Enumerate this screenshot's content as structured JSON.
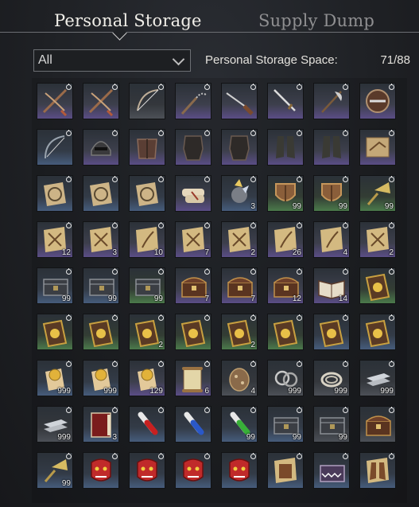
{
  "tabs": {
    "personal": "Personal Storage",
    "supply": "Supply Dump"
  },
  "filter": {
    "selected": "All"
  },
  "storage": {
    "label": "Personal Storage Space:",
    "count": "71/88"
  },
  "colors": {
    "purple": "#5a4d86",
    "blue": "#465c7c",
    "green": "#4b7a4b",
    "gray": "#4c5057",
    "red": "#6a3e48"
  },
  "items": [
    {
      "icon": "crossbow-icon",
      "rarity": "purple",
      "qty": ""
    },
    {
      "icon": "crossbow-icon",
      "rarity": "purple",
      "qty": ""
    },
    {
      "icon": "longbow-icon",
      "rarity": "gray",
      "qty": ""
    },
    {
      "icon": "chain-flail-icon",
      "rarity": "purple",
      "qty": ""
    },
    {
      "icon": "musket-icon",
      "rarity": "purple",
      "qty": ""
    },
    {
      "icon": "sword-icon",
      "rarity": "purple",
      "qty": ""
    },
    {
      "icon": "halberd-icon",
      "rarity": "purple",
      "qty": ""
    },
    {
      "icon": "shield-round-icon",
      "rarity": "purple",
      "qty": ""
    },
    {
      "icon": "bow-blue-icon",
      "rarity": "blue",
      "qty": ""
    },
    {
      "icon": "helmet-icon",
      "rarity": "purple",
      "qty": ""
    },
    {
      "icon": "armor-chest-icon",
      "rarity": "purple",
      "qty": ""
    },
    {
      "icon": "armor-suit-icon",
      "rarity": "purple",
      "qty": ""
    },
    {
      "icon": "armor-suit-icon",
      "rarity": "purple",
      "qty": ""
    },
    {
      "icon": "boots-icon",
      "rarity": "purple",
      "qty": ""
    },
    {
      "icon": "boots-icon",
      "rarity": "purple",
      "qty": ""
    },
    {
      "icon": "map-scroll-icon",
      "rarity": "purple",
      "qty": ""
    },
    {
      "icon": "medallion-icon",
      "rarity": "blue",
      "qty": ""
    },
    {
      "icon": "medallion-icon",
      "rarity": "blue",
      "qty": ""
    },
    {
      "icon": "medallion-icon",
      "rarity": "blue",
      "qty": ""
    },
    {
      "icon": "scroll-bundle-icon",
      "rarity": "purple",
      "qty": ""
    },
    {
      "icon": "crystal-ore-icon",
      "rarity": "blue",
      "qty": "3"
    },
    {
      "icon": "wooden-shield-icon",
      "rarity": "green",
      "qty": "99"
    },
    {
      "icon": "wooden-shield-icon",
      "rarity": "green",
      "qty": "99"
    },
    {
      "icon": "brass-horn-icon",
      "rarity": "green",
      "qty": "99"
    },
    {
      "icon": "crossed-weapons-map-icon",
      "rarity": "purple",
      "qty": "12"
    },
    {
      "icon": "crossed-weapons-map-icon",
      "rarity": "purple",
      "qty": "3"
    },
    {
      "icon": "feather-map-icon",
      "rarity": "purple",
      "qty": "10"
    },
    {
      "icon": "crossed-weapons-map-icon",
      "rarity": "purple",
      "qty": "7"
    },
    {
      "icon": "crossed-weapons-map-icon",
      "rarity": "purple",
      "qty": "2"
    },
    {
      "icon": "feather-map-icon",
      "rarity": "purple",
      "qty": "26"
    },
    {
      "icon": "feather-map-icon",
      "rarity": "purple",
      "qty": "4"
    },
    {
      "icon": "crossed-weapons-map-icon",
      "rarity": "purple",
      "qty": "2"
    },
    {
      "icon": "supply-crate-icon",
      "rarity": "blue",
      "qty": "99"
    },
    {
      "icon": "supply-crate-icon",
      "rarity": "blue",
      "qty": "99"
    },
    {
      "icon": "supply-crate-icon",
      "rarity": "green",
      "qty": "99"
    },
    {
      "icon": "treasure-chest-icon",
      "rarity": "purple",
      "qty": "7"
    },
    {
      "icon": "treasure-chest-icon",
      "rarity": "purple",
      "qty": "7"
    },
    {
      "icon": "treasure-chest-icon",
      "rarity": "purple",
      "qty": "12"
    },
    {
      "icon": "open-book-icon",
      "rarity": "purple",
      "qty": "14"
    },
    {
      "icon": "gold-tome-icon",
      "rarity": "green",
      "qty": ""
    },
    {
      "icon": "gold-tome-icon",
      "rarity": "green",
      "qty": ""
    },
    {
      "icon": "gold-tome-icon",
      "rarity": "green",
      "qty": ""
    },
    {
      "icon": "gold-tome-icon",
      "rarity": "green",
      "qty": "2"
    },
    {
      "icon": "gold-tome-icon",
      "rarity": "green",
      "qty": ""
    },
    {
      "icon": "gold-tome-icon",
      "rarity": "green",
      "qty": "2"
    },
    {
      "icon": "gold-tome-icon",
      "rarity": "green",
      "qty": ""
    },
    {
      "icon": "gold-tome-icon",
      "rarity": "blue",
      "qty": ""
    },
    {
      "icon": "gold-tome-icon",
      "rarity": "blue",
      "qty": ""
    },
    {
      "icon": "gold-seal-scroll-icon",
      "rarity": "blue",
      "qty": "999"
    },
    {
      "icon": "gold-seal-scroll-icon",
      "rarity": "blue",
      "qty": "999"
    },
    {
      "icon": "gold-seal-scroll-icon",
      "rarity": "purple",
      "qty": "129"
    },
    {
      "icon": "parchment-scroll-icon",
      "rarity": "purple",
      "qty": "6"
    },
    {
      "icon": "ore-lump-icon",
      "rarity": "gray",
      "qty": "4"
    },
    {
      "icon": "iron-rings-icon",
      "rarity": "gray",
      "qty": "999"
    },
    {
      "icon": "rope-coil-icon",
      "rarity": "gray",
      "qty": "999"
    },
    {
      "icon": "metal-ingots-icon",
      "rarity": "gray",
      "qty": "999"
    },
    {
      "icon": "metal-ingots-icon",
      "rarity": "gray",
      "qty": "999"
    },
    {
      "icon": "red-book-icon",
      "rarity": "blue",
      "qty": "3"
    },
    {
      "icon": "red-potion-icon",
      "rarity": "blue",
      "qty": ""
    },
    {
      "icon": "blue-potion-icon",
      "rarity": "blue",
      "qty": ""
    },
    {
      "icon": "green-potion-icon",
      "rarity": "blue",
      "qty": "99"
    },
    {
      "icon": "supply-crate-icon",
      "rarity": "blue",
      "qty": "99"
    },
    {
      "icon": "supply-crate-icon",
      "rarity": "gray",
      "qty": "99"
    },
    {
      "icon": "treasure-chest-icon",
      "rarity": "gray",
      "qty": ""
    },
    {
      "icon": "brass-horn-icon",
      "rarity": "blue",
      "qty": "99"
    },
    {
      "icon": "demon-mask-icon",
      "rarity": "blue",
      "qty": ""
    },
    {
      "icon": "demon-mask-icon",
      "rarity": "blue",
      "qty": ""
    },
    {
      "icon": "demon-mask-icon",
      "rarity": "blue",
      "qty": ""
    },
    {
      "icon": "demon-mask-icon",
      "rarity": "blue",
      "qty": ""
    },
    {
      "icon": "armor-pattern-icon",
      "rarity": "blue",
      "qty": ""
    },
    {
      "icon": "fanged-chest-icon",
      "rarity": "blue",
      "qty": ""
    },
    {
      "icon": "boots-pattern-icon",
      "rarity": "blue",
      "qty": ""
    }
  ]
}
